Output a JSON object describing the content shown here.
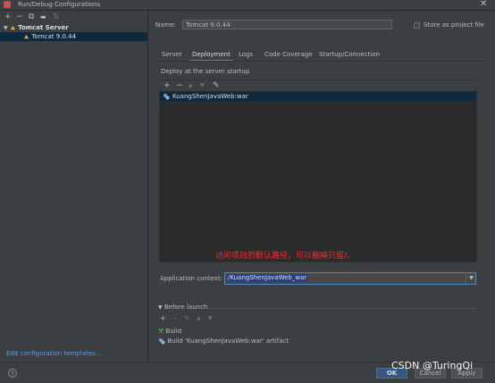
{
  "window": {
    "title": "Run/Debug Configurations"
  },
  "left_panel": {
    "toolbar": [
      {
        "name": "add-icon",
        "glyph": "+"
      },
      {
        "name": "remove-icon",
        "glyph": "−"
      },
      {
        "name": "copy-icon",
        "glyph": "⧉"
      },
      {
        "name": "folder-icon",
        "glyph": "▬"
      },
      {
        "name": "sort-icon",
        "glyph": "⇅"
      }
    ],
    "tree": {
      "group_label": "Tomcat Server",
      "item_label": "Tomcat 9.0.44"
    },
    "edit_templates_link": "Edit configuration templates..."
  },
  "config": {
    "name_label": "Name:",
    "name_value": "Tomcat 9.0.44",
    "store_label": "Store as project file",
    "tabs": [
      {
        "label": "Server",
        "active": false
      },
      {
        "label": "Deployment",
        "active": true
      },
      {
        "label": "Logs",
        "active": false
      },
      {
        "label": "Code Coverage",
        "active": false
      },
      {
        "label": "Startup/Connection",
        "active": false
      }
    ],
    "deploy_label": "Deploy at the server startup",
    "deploy_toolbar": [
      {
        "name": "add-icon",
        "glyph": "+"
      },
      {
        "name": "remove-icon",
        "glyph": "−"
      },
      {
        "name": "move-up-icon",
        "glyph": "▲"
      },
      {
        "name": "move-down-icon",
        "glyph": "▼"
      },
      {
        "name": "edit-icon",
        "glyph": "✎"
      }
    ],
    "artifact": "KuangShenJavaWeb:war",
    "annotation": "访问项目的默认路径，可以删掉只留/。",
    "context_label": "Application context:",
    "context_value": "/KuangShenJavaWeb_war",
    "before_launch": {
      "heading": "Before launch",
      "toolbar": [
        {
          "name": "add-icon",
          "glyph": "+"
        },
        {
          "name": "remove-icon",
          "glyph": "−"
        },
        {
          "name": "edit-icon",
          "glyph": "✎"
        },
        {
          "name": "move-up-icon",
          "glyph": "▲"
        },
        {
          "name": "move-down-icon",
          "glyph": "▼"
        }
      ],
      "items": [
        "Build",
        "Build 'KuangShenJavaWeb:war' artifact"
      ]
    }
  },
  "buttons": {
    "help": "?",
    "ok": "OK",
    "cancel": "Cancel",
    "apply": "Apply"
  },
  "watermark": "CSDN @TuringQi",
  "colors": {
    "accent": "#4a88c7",
    "selection": "#0d293e",
    "annotation": "#ff2a2a",
    "link": "#589df6"
  }
}
